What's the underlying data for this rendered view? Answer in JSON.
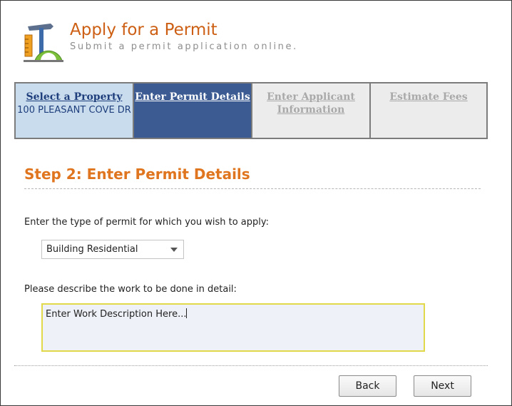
{
  "header": {
    "title": "Apply for a Permit",
    "subtitle": "Submit a permit application online.",
    "icon": "permit-tools-icon"
  },
  "wizard": {
    "steps": [
      {
        "title": "Select a Property",
        "sub": "100 PLEASANT COVE DR",
        "state": "completed"
      },
      {
        "title": "Enter Permit Details",
        "sub": "",
        "state": "active"
      },
      {
        "title": "Enter Applicant Information",
        "sub": "",
        "state": "disabled"
      },
      {
        "title": "Estimate Fees",
        "sub": "",
        "state": "disabled"
      }
    ]
  },
  "main": {
    "section_title": "Step 2: Enter Permit Details",
    "permit_type_label": "Enter the type of permit for which you wish to apply:",
    "permit_type_selected": "Building Residential",
    "description_label": "Please describe the work to be done in detail:",
    "description_value": "Enter Work Description Here..."
  },
  "footer": {
    "back_label": "Back",
    "next_label": "Next"
  },
  "colors": {
    "title_orange": "#cc5f13",
    "section_orange": "#e07520",
    "active_step_blue": "#3b5b92",
    "completed_step_blue": "#c9dcee",
    "textarea_border": "#e2d94a"
  }
}
